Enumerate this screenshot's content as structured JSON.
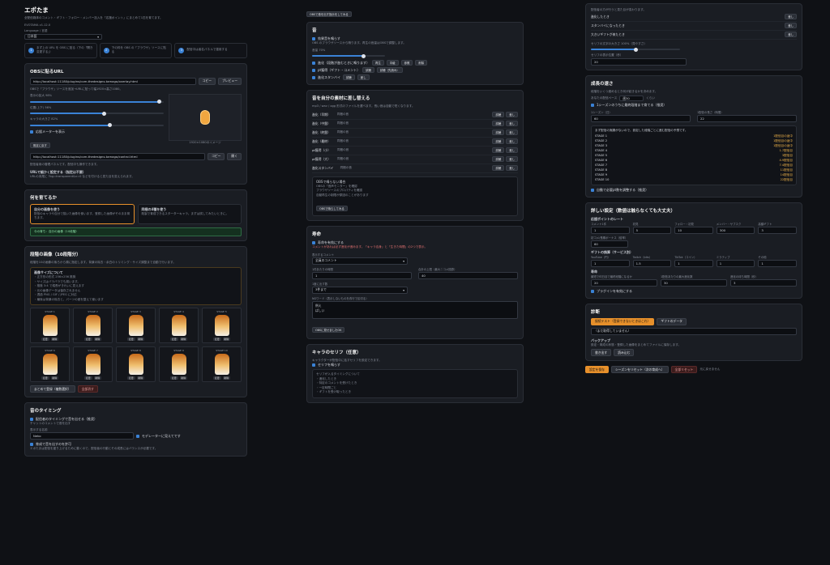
{
  "app": {
    "title": "エポたま",
    "subtitle": "全配信媒体のコメント・ギフト・フォロー・メンバー加入を「応援ポイント」にまとめて1匹を育てます。",
    "version": "EVOTAMA v1.12.0",
    "lang_label": "Language / 言語",
    "lang_value": "日本語"
  },
  "steps": [
    "まず上の URL を OBS に貼る（下の「開き変更する」）",
    "下の枠を OBS の「ブラウザ」ソースに貼る",
    "配信中は者名パネルで運用する"
  ],
  "obs": {
    "title": "OBSに貼るURL",
    "url1": "http://localhost:11180/plugins/com.thedesigns.tamago/overlay.html",
    "copy": "コピー",
    "preview": "プレビュー",
    "note": "OBSで「ブラウザ」ソースを追加→URLに貼って幅1920×高さ1080。",
    "size_label": "表示の拡大 98%",
    "y_label": "位置(上下) 56%",
    "x_label": "キャラの大きさ 82%",
    "preview_caption": "1920×1080のイメージ",
    "auto_check": "応援メーターを表示",
    "reset": "既定に戻す",
    "url2": "http://localhost:11180/plugins/com.thedesigns.tamago/control.html",
    "open": "開く",
    "control_note": "配信者用の管理パネルです。配信中も操作できます。",
    "section": "URLで細かく設定する（指定は不要）",
    "line1": "URLの末尾に ?bg=transparent&v=0 などを付けると見た目を変えられます。"
  },
  "raise": {
    "title": "何を育てるか",
    "opt1_title": "自分の画像を使う",
    "opt1_desc": "配信のキャラや自分で描いた画像を使います。登録した画像がそのまま育ちます。",
    "opt2_title": "同梱の4種を使う",
    "opt2_desc": "既製で育成できるスターターキャラ。まずは試してみたいときに。",
    "notice": "今の育ち：自分の画像（10段階）"
  },
  "images": {
    "title": "段階の画像（10段階分）",
    "desc": "段階を10の画像の後ろから順に指定します。背景の除去・余白のトリミング・サイズ調整まで自動で行います。",
    "rules_title": "画像サイズについて",
    "rules": [
      "・正方形の形式 256×256 推奨",
      "・サイズはバラバラでも揃います。",
      "・推奨 3:4 で縦長がきれいに見えます",
      "・元の画像データは保存されません",
      "・透過 PNG / GIF / JPEG に対応",
      "・最後は背景の除去と、パーツの差を整えて使います"
    ],
    "stages": [
      "STAGE 1",
      "STAGE 2",
      "STAGE 3",
      "STAGE 4",
      "STAGE 5",
      "STAGE 6",
      "STAGE 7",
      "STAGE 8",
      "STAGE 9",
      "STAGE 10"
    ],
    "change": "変更",
    "delete": "削除",
    "bulk": "まとめて登録（複数選択）",
    "clear": "全部消す"
  },
  "mood": {
    "title": "音のタイミング",
    "c1": "配信者のタイミングで音を出せる（推奨）",
    "sub": "チャットのコメントで音を出す",
    "name_label": "表示する名前",
    "name_value": "Neko",
    "c2": "モデレーターに見えてです",
    "c3": "育成で音を出すのを許可",
    "desc": "エポたまは配信を盛り上げるために動くので、配信者の行動とその成長にはバランスが必要です。"
  },
  "c2": {
    "top_btn": "OBSで音を出す指示をしてみる",
    "sound_title": "音",
    "sound_check": "効果音を鳴らす",
    "sound_desc": "OBS のブラウザソースから鳴ります。再生の音量はOBSで調整します。",
    "vol_label": "音量 70%",
    "items": [
      {
        "label": "進化（段階が進むときに鳴ります）",
        "b": [
          "再生",
          "中級",
          "参照",
          "削除"
        ]
      },
      {
        "label": "pt獲得（ギフト・コメント）",
        "b": [
          "試聴",
          "試聴（先読み）"
        ]
      },
      {
        "label": "進化スタンバイ",
        "b": [
          "試聴",
          "差し"
        ]
      }
    ],
    "list_title": "音を自分の素材に差し替える",
    "list_desc": "mp3 / wav / ogg 形式のファイルを選べます。長い音は自動で短くなります。",
    "rows": [
      "進化（早期）",
      "進化（中盤）",
      "進化（終盤）",
      "進化（最終）",
      "pt獲得（小）",
      "pt獲得（大）",
      "進化スタンバイ"
    ],
    "row_hint": "同梱の音",
    "test": "試聴",
    "rep": "差し",
    "alert_title": "OBSで鳴らない場合",
    "alert_lines": [
      "OBSの「音声モニター」を確認",
      "ブラウザソースのプロパティを確認",
      "自動再生の制限が原因のことがあります"
    ],
    "obs_test": "OBSで鳴らしてみる",
    "progress_title": "寿命",
    "progress_check": "寿命を有効にする",
    "progress_desc": "コメントがあれば必ず進化が進みます。「キャラ自身」と「生きた時間」の2つで表示。",
    "sel1_label": "表示するコメント",
    "sel1_value": "全員のコメント",
    "in1_label": "1件あたりの時間",
    "in1_value": "1",
    "in2_label": "合計の上限（最大ニコメ換算）",
    "in2_value": "40",
    "sel2_label": "1度に出す数",
    "sel2_value": "3件まで",
    "area_label": "NGワード（表示しないものを改行で区切る）",
    "area_value": "例え\nばしい",
    "save_note": "OBSに見せましたOK",
    "speech_title": "キャラのセリフ（任意）",
    "speech_desc": "キャラクターが配信中に話すセリフを設定できます。",
    "speech_check": "セリフを鳴らす",
    "speech_lines": [
      "セリフが入るタイミングについて",
      "・進化したとき",
      "・特定のコメントを受けたとき",
      "・一定時間ごと",
      "・ギフトを受け取ったとき"
    ]
  },
  "c3": {
    "top_note": "配信者の方が行うと見た目が変わります。",
    "lines": [
      {
        "k": "進化したとき",
        "v": "差し"
      },
      {
        "k": "スタンバイになったとき",
        "v": "差し"
      },
      {
        "k": "大きいギフトが来たとき",
        "v": "差し"
      }
    ],
    "size_label": "セリフの文字の大きさ 100%（見やすさ）",
    "pos_label": "セリフの表示位置（秒）",
    "pos_value": "20",
    "growth_title": "成長の速さ",
    "growth_desc": "段階をいくつ進めるとき何が起きるかを決めます。",
    "reach_label": "あなたの配信ペース",
    "reach_value": "週30",
    "reach_unit": "くらい",
    "chk1": "1シーズンのうちに最終段階まで育てる（推奨）",
    "in_a_label": "1シーズン（日）",
    "in_a_value": "60",
    "in_b_label": "1配信の長さ（時間）",
    "in_b_value": "22",
    "stage_table_title": "まず配信の実績がないので、設定した段階ごとに進む配信の予想です。",
    "stages": [
      {
        "k": "STAGE 1",
        "v": "1配信目の途中"
      },
      {
        "k": "STAGE 2",
        "v": "1配信目の途中"
      },
      {
        "k": "STAGE 3",
        "v": "1配信目の途中"
      },
      {
        "k": "STAGE 4",
        "v": "1.7配信目"
      },
      {
        "k": "STAGE 5",
        "v": "3配信目"
      },
      {
        "k": "STAGE 6",
        "v": "4.9配信目"
      },
      {
        "k": "STAGE 7",
        "v": "7.4配信目"
      },
      {
        "k": "STAGE 8",
        "v": "11配信目"
      },
      {
        "k": "STAGE 9",
        "v": "14配信目"
      },
      {
        "k": "STAGE 10",
        "v": "22配信目"
      }
    ],
    "chk2": "自動で必要pt数を調整する（推奨）",
    "detail_title": "詳しい設定（数値は触らなくても大丈夫）",
    "point_title": "応援ポイントのレート",
    "point_fields": [
      {
        "l": "コメント1件",
        "v": "1"
      },
      {
        "l": "初見",
        "v": "5"
      },
      {
        "l": "フォロー・初見",
        "v": "10"
      },
      {
        "l": "メンバー・サブスク",
        "v": "300"
      },
      {
        "l": "高額ギフト",
        "v": "3"
      }
    ],
    "point_extra_label": "初コメ/長期ボーナス（倍率）",
    "point_extra_value": "60",
    "gift_title": "ギフトの換算（サービス別）",
    "gift_fields": [
      {
        "l": "YouTube（円）",
        "v": "1"
      },
      {
        "l": "Twitch（bits）",
        "v": "1.5"
      },
      {
        "l": "TikTok（コイン）",
        "v": "1"
      },
      {
        "l": "ミラティブ",
        "v": "1"
      },
      {
        "l": "その他",
        "v": "1"
      }
    ],
    "pace_title": "寿命",
    "pace_fields": [
      {
        "l": "最短で何日目で最終段階になるか",
        "v": "20"
      },
      {
        "l": "1配信あたりの最大進化数",
        "v": "30"
      },
      {
        "l": "進化の待ち時間（秒）",
        "v": "3"
      }
    ],
    "plugin_check": "プラグインを有効にする",
    "diag_title": "診断",
    "diag_btn1": "接続テスト（登録できないときはこれ）",
    "diag_btn2": "ギフトのデータ",
    "diag_input": "（まだ取得していません）",
    "backup_title": "バックアップ",
    "backup_desc": "設定・育成の状態・登録した画像をまとめてファイルに保存します。",
    "save_btn": "書き出す",
    "load_btn": "読み込む",
    "final_save": "設定を保存",
    "reset_season": "シーズンをリセット（次の育成へ）",
    "reset_all": "全部リセット",
    "last": "元に戻せません"
  }
}
